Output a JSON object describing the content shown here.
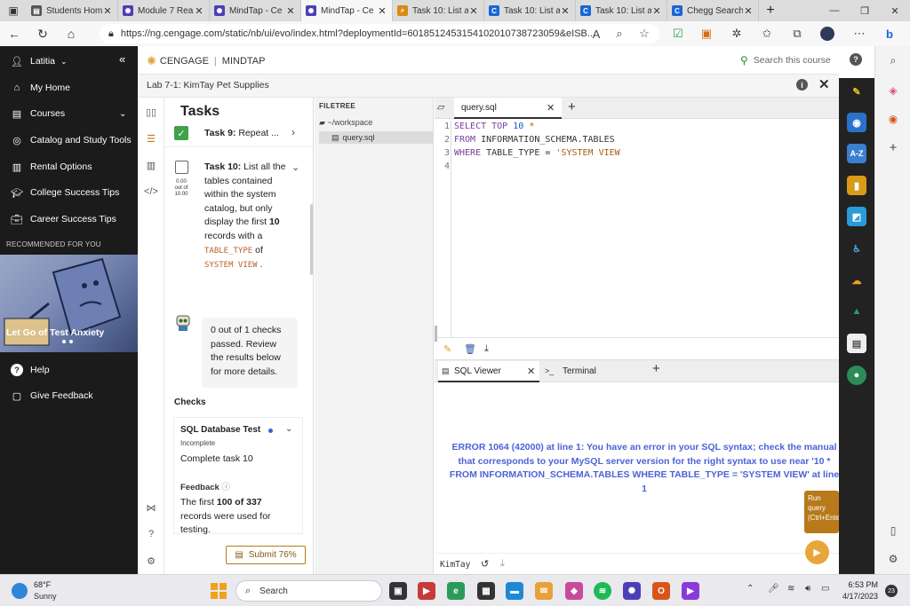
{
  "browser": {
    "tabs": [
      {
        "title": "Students Hom",
        "icon": "doc-icon",
        "color": "#555555",
        "active": false
      },
      {
        "title": "Module 7 Rea",
        "icon": "cengage-icon",
        "color": "#4b3fb8",
        "active": false
      },
      {
        "title": "MindTap - Ce",
        "icon": "cengage-icon",
        "color": "#4b3fb8",
        "active": false
      },
      {
        "title": "MindTap - Ce",
        "icon": "cengage-icon",
        "color": "#4b3fb8",
        "active": true
      },
      {
        "title": "Task 10: List a",
        "icon": "search-icon",
        "color": "#d98a14",
        "active": false
      },
      {
        "title": "Task 10: List a",
        "icon": "chegg-icon",
        "color": "#1a66d6",
        "active": false
      },
      {
        "title": "Task 10: List a",
        "icon": "chegg-icon",
        "color": "#1a66d6",
        "active": false
      },
      {
        "title": "Chegg Search",
        "icon": "chegg-icon",
        "color": "#1a66d6",
        "active": false
      }
    ],
    "url": "https://ng.cengage.com/static/nb/ui/evo/index.html?deploymentId=6018512453154102010738723059&eISB..."
  },
  "nav": {
    "user": "Latitia",
    "items": [
      {
        "label": "My Home",
        "icon": "home-icon"
      },
      {
        "label": "Courses",
        "icon": "book-icon"
      },
      {
        "label": "Catalog and Study Tools",
        "icon": "compass-icon"
      },
      {
        "label": "Rental Options",
        "icon": "rental-icon"
      },
      {
        "label": "College Success Tips",
        "icon": "cap-icon"
      },
      {
        "label": "Career Success Tips",
        "icon": "briefcase-icon"
      }
    ],
    "recommended_label": "RECOMMENDED FOR YOU",
    "recommended_title": "Let Go of Test Anxiety",
    "help": "Help",
    "feedback": "Give Feedback"
  },
  "header": {
    "brand_cengage": "CENGAGE",
    "brand_mindtap": "MINDTAP",
    "search_placeholder": "Search this course",
    "lab_title": "Lab 7-1: KimTay Pet Supplies"
  },
  "tasks": {
    "title": "Tasks",
    "task9_label": "Task 9:",
    "task9_text": "Repeat ...",
    "task10_label": "Task 10:",
    "task10_text_1": "List all the tables contained within the system catalog, but only display the first",
    "task10_bold": "10",
    "task10_text_2": "records with a",
    "task10_code_1": "TABLE_TYPE",
    "task10_text_3": "of",
    "task10_code_2": "SYSTEM VIEW",
    "task10_text_4": ".",
    "score_value": "0.00",
    "score_of": "out of",
    "score_total": "10.00",
    "check_summary": "0 out of 1 checks passed. Review the results below for more details.",
    "checks_heading": "Checks",
    "check_name": "SQL Database Test",
    "check_status": "Incomplete",
    "check_desc": "Complete task 10",
    "feedback_label": "Feedback",
    "feedback_pre": "The first",
    "feedback_bold": "100 of 337",
    "feedback_post": "records were used for testing.",
    "submit_label": "Submit 76%"
  },
  "filetree": {
    "heading": "FILETREE",
    "workspace": "~/workspace",
    "file": "query.sql"
  },
  "editor": {
    "tab": "query.sql",
    "line_numbers": [
      "1",
      "2",
      "3",
      "4"
    ],
    "code": {
      "l1_kw": "SELECT TOP",
      "l1_num": "10",
      "l1_rest": "*",
      "l2_kw": "FROM",
      "l2_rest": "INFORMATION_SCHEMA.TABLES",
      "l3_kw": "WHERE",
      "l3_rest": "TABLE_TYPE =",
      "l3_str": "'SYSTEM VIEW"
    }
  },
  "bottom_panel": {
    "sql_viewer_tab": "SQL Viewer",
    "terminal_tab": "Terminal",
    "error": "ERROR 1064 (42000) at line 1: You have an error in your SQL syntax; check the manual that corresponds to your MySQL server version for the right syntax to use near '10 * FROM INFORMATION_SCHEMA.TABLES WHERE TABLE_TYPE = 'SYSTEM VIEW' at line 1",
    "db_name": "KimTay",
    "run_tooltip": "Run query (Ctrl+Enter)"
  },
  "taskbar": {
    "temp": "68°F",
    "condition": "Sunny",
    "search": "Search",
    "time": "6:53 PM",
    "date": "4/17/2023",
    "notifications": "23"
  },
  "colors": {
    "error_text": "#4b63d6",
    "accent": "#e8a63a",
    "check_green": "#3fa14a"
  }
}
